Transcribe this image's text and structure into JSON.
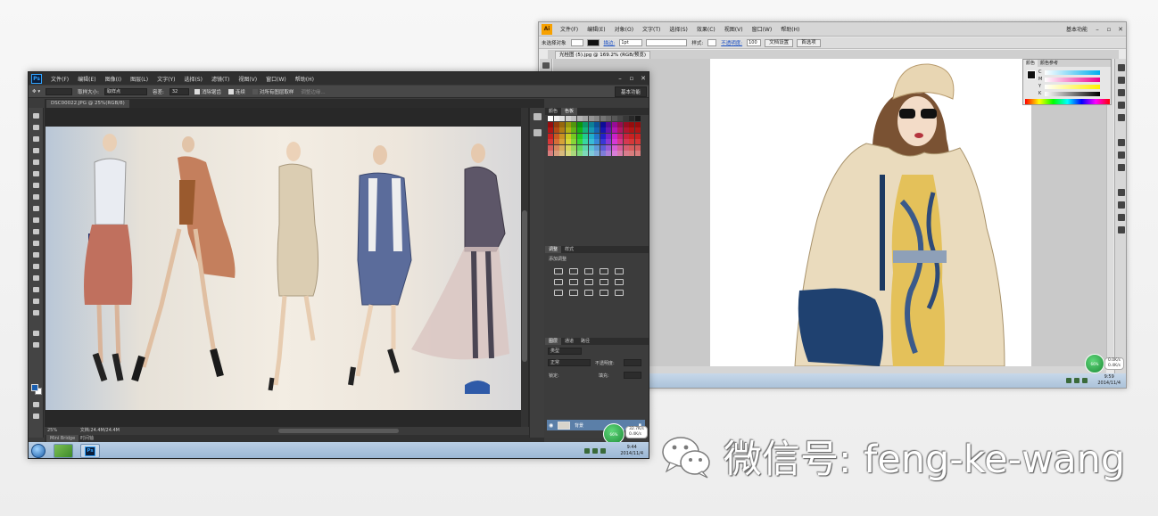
{
  "illustrator": {
    "logo": "Ai",
    "menus": [
      "文件(F)",
      "编辑(E)",
      "对象(O)",
      "文字(T)",
      "选择(S)",
      "效果(C)",
      "视图(V)",
      "窗口(W)",
      "帮助(H)"
    ],
    "workspace": "基本功能",
    "control": {
      "selection_label": "未选择对象",
      "stroke_link": "描边:",
      "stroke_weight": "1pt",
      "style_label": "样式:",
      "opacity_link": "不透明度:",
      "opacity_value": "100",
      "doc_setup": "文档设置",
      "preferences": "首选项"
    },
    "doc_tab": "光桂图 (5).jpg @ 169.2% (RGB/预览)",
    "color_panel": {
      "tab_color": "颜色",
      "tab_guide": "颜色参考",
      "rows": [
        "C",
        "M",
        "Y",
        "K"
      ],
      "pct": "%"
    },
    "status_left": "选择",
    "taskbar": {
      "time": "9:59",
      "date": "2014/11/4"
    },
    "net": {
      "badge": "66%",
      "up": "0.0K/s",
      "down": "0.4K/s"
    },
    "colors": {
      "chrome": "#e9e9e9",
      "accent": "#f7a100"
    }
  },
  "photoshop": {
    "logo": "Ps",
    "menus": [
      "文件(F)",
      "编辑(E)",
      "图像(I)",
      "图层(L)",
      "文字(Y)",
      "选择(S)",
      "滤镜(T)",
      "视图(V)",
      "窗口(W)",
      "帮助(H)"
    ],
    "options": {
      "style_label": "取样大小:",
      "style_value": "取样点",
      "tolerance_label": "容差:",
      "tolerance_value": "32",
      "antialias": "消除锯齿",
      "contiguous": "连续",
      "sample_all": "对所有图层取样",
      "refine": "调整边缘..."
    },
    "workspace": "基本功能",
    "doc_tab": "DSC00022.JPG @ 25%(RGB/8)",
    "status": {
      "zoom": "25%",
      "doc": "文档:24.4M/24.4M"
    },
    "bridge": {
      "tab1": "Mini Bridge",
      "tab2": "时间轴"
    },
    "panels": {
      "swatches_tabs": [
        "颜色",
        "色板"
      ],
      "adjust_tabs": [
        "调整",
        "样式"
      ],
      "adjust_title": "添加调整",
      "layers_tabs": [
        "图层",
        "通道",
        "路径"
      ],
      "kind": "类型",
      "blend": "正常",
      "opacity": "不透明度:",
      "lock": "锁定:",
      "fill": "填充:",
      "layer_name": "背景"
    },
    "taskbar": {
      "time": "9:44",
      "date": "2014/11/4",
      "ps_label": "Ps"
    },
    "net": {
      "badge": "66%",
      "up": "32.7K/s",
      "down": "0.4K/s"
    },
    "colors": {
      "chrome": "#3b3b3b",
      "accent": "#2fa3ff"
    }
  },
  "watermark": {
    "text": "微信号: feng-ke-wang",
    "icon": "wechat-icon"
  }
}
